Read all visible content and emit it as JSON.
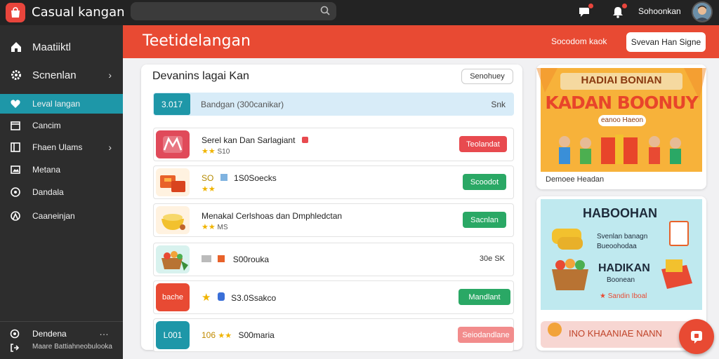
{
  "app": {
    "title": "Casual kangan",
    "user_name": "Sohoonkan"
  },
  "header": {
    "title": "Teetidelangan",
    "link": "Socodom kaok",
    "button": "Svevan Han Signe"
  },
  "sidebar": {
    "items": [
      {
        "label": "Maatiiktl",
        "icon": "home-icon"
      },
      {
        "label": "Scnenlan",
        "icon": "gear-icon",
        "chevron": true
      },
      {
        "label": "Leval langan",
        "icon": "heart-icon",
        "active": true
      },
      {
        "label": "Cancim",
        "icon": "calendar-icon"
      },
      {
        "label": "Fhaen Ulams",
        "icon": "grid-icon",
        "chevron": true
      },
      {
        "label": "Metana",
        "icon": "image-icon"
      },
      {
        "label": "Dandala",
        "icon": "clock-icon"
      },
      {
        "label": "Caaneinjan",
        "icon": "help-icon"
      }
    ],
    "footer": {
      "line1": "Dendena",
      "line2": "Maare Battiahneobulooka"
    }
  },
  "main": {
    "title": "Devanins lagai Kan",
    "button": "Senohuey",
    "filter": {
      "tag": "3.017",
      "placeholder": "Bandgan (300canikar)",
      "sort": "Snk"
    },
    "rows": [
      {
        "line1": "Serel kan Dan Sarlagiant",
        "stars": "★★",
        "line2": "S10",
        "action": "Teolandat",
        "action_color": "#e84a4f",
        "meta": ""
      },
      {
        "line1": "SO",
        "stars": "★★",
        "line2": "",
        "extra": "1S0Soecks",
        "action": "Scoodot",
        "action_color": "#2aa865",
        "meta": ""
      },
      {
        "line1": "Menakal Cerlshoas dan Dmphledctan",
        "stars": "★★",
        "line2": "MS",
        "action": "Sacnlan",
        "action_color": "#2aa865",
        "meta": ""
      },
      {
        "line1": "S00rouka",
        "stars": "",
        "line2": "",
        "action": "",
        "action_color": "",
        "meta": "30e SK"
      },
      {
        "line1": "S3.0Ssakco",
        "stars": "★",
        "line2": "",
        "action": "Mandlant",
        "action_color": "#2aa865",
        "meta": ""
      },
      {
        "line1": "S00maria",
        "stars": "★★",
        "line2": "106",
        "action": "Seiodandlane",
        "action_color": "#f28c8c",
        "meta": ""
      }
    ],
    "row_thumbs": [
      {
        "label": "",
        "color": "#e04a5a"
      },
      {
        "label": "",
        "color": "#fff2e0"
      },
      {
        "label": "",
        "color": "#fff2e0"
      },
      {
        "label": "",
        "color": "#d8f2ee"
      },
      {
        "label": "bache",
        "color": "#e84a33"
      },
      {
        "label": "L001",
        "color": "#1e97a8"
      }
    ]
  },
  "promos": {
    "p1": {
      "banner1": "HADIAI BONIAN",
      "banner2": "KADAN BOONUY",
      "banner3": "eanoo Haeon",
      "caption": "Demoee Headan"
    },
    "p2": {
      "title": "HABOOHAN",
      "text1": "Svenlan banagn",
      "text2": "Bueoohodaa",
      "title2": "HADIKAN",
      "text3": "Boonean",
      "text4": "Sandin Iboal",
      "footer": "INO KHAANIAE NANN"
    }
  },
  "colors": {
    "accent": "#e84a33",
    "teal": "#1e97a8",
    "green": "#2aa865"
  }
}
